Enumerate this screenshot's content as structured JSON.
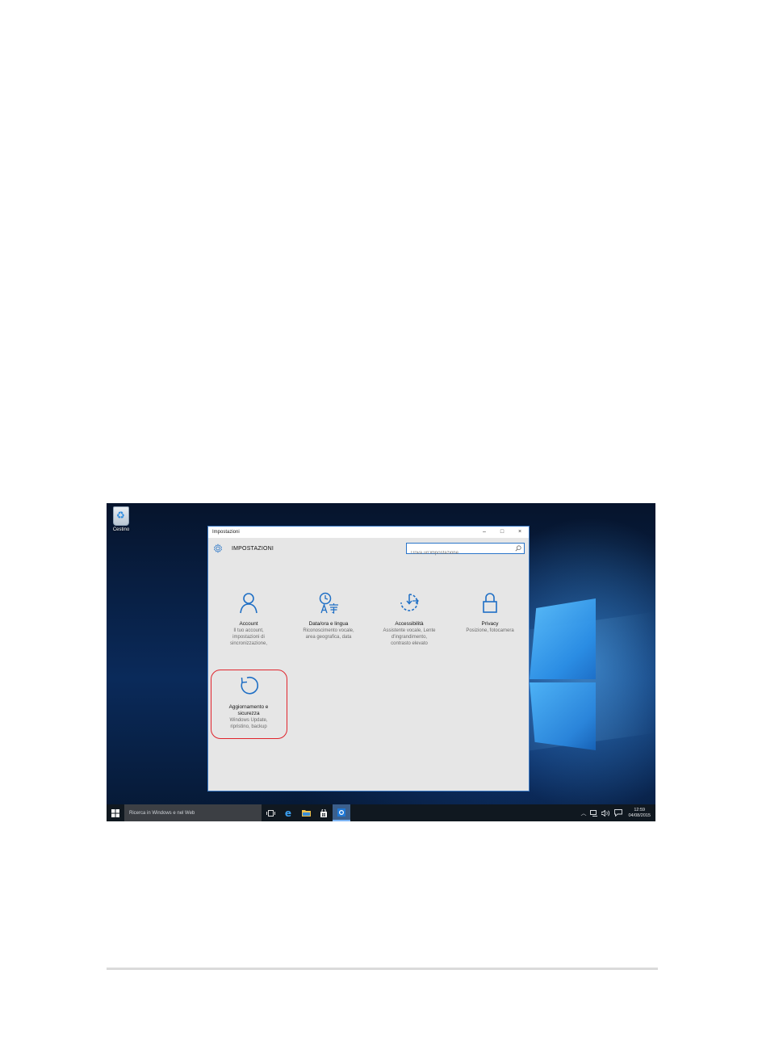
{
  "desktop": {
    "recycle_bin_label": "Cestino"
  },
  "window": {
    "title": "Impostazioni",
    "controls": {
      "minimize": "–",
      "maximize": "□",
      "close": "×"
    },
    "heading": "IMPOSTAZIONI",
    "search": {
      "placeholder": "Trova un'impostazione"
    }
  },
  "tiles": [
    {
      "title": "Account",
      "desc": [
        "Il tuo account,",
        "impostazioni di",
        "sincronizzazione,"
      ],
      "icon": "person-icon"
    },
    {
      "title": "Data/ora e lingua",
      "desc": [
        "Riconoscimento vocale,",
        "area geografica, data"
      ],
      "icon": "clock-language-icon"
    },
    {
      "title": "Accessibilità",
      "desc": [
        "Assistente vocale, Lente",
        "d'ingrandimento,",
        "contrasto elevato"
      ],
      "icon": "accessibility-icon"
    },
    {
      "title": "Privacy",
      "desc": [
        "Posizione, fotocamera"
      ],
      "icon": "lock-icon"
    },
    {
      "title": "Aggiornamento e sicurezza",
      "title_lines": [
        "Aggiornamento e",
        "sicurezza"
      ],
      "desc": [
        "Windows Update,",
        "ripristino, backup"
      ],
      "icon": "update-icon"
    }
  ],
  "taskbar": {
    "search_text": "Ricerca in Windows e nel Web",
    "time": "12:59",
    "date": "04/08/2015"
  },
  "colors": {
    "accent": "#1f6fc5",
    "highlight": "#e0242c",
    "window_bg": "#e6e6e6",
    "taskbar_bg": "#101820"
  }
}
